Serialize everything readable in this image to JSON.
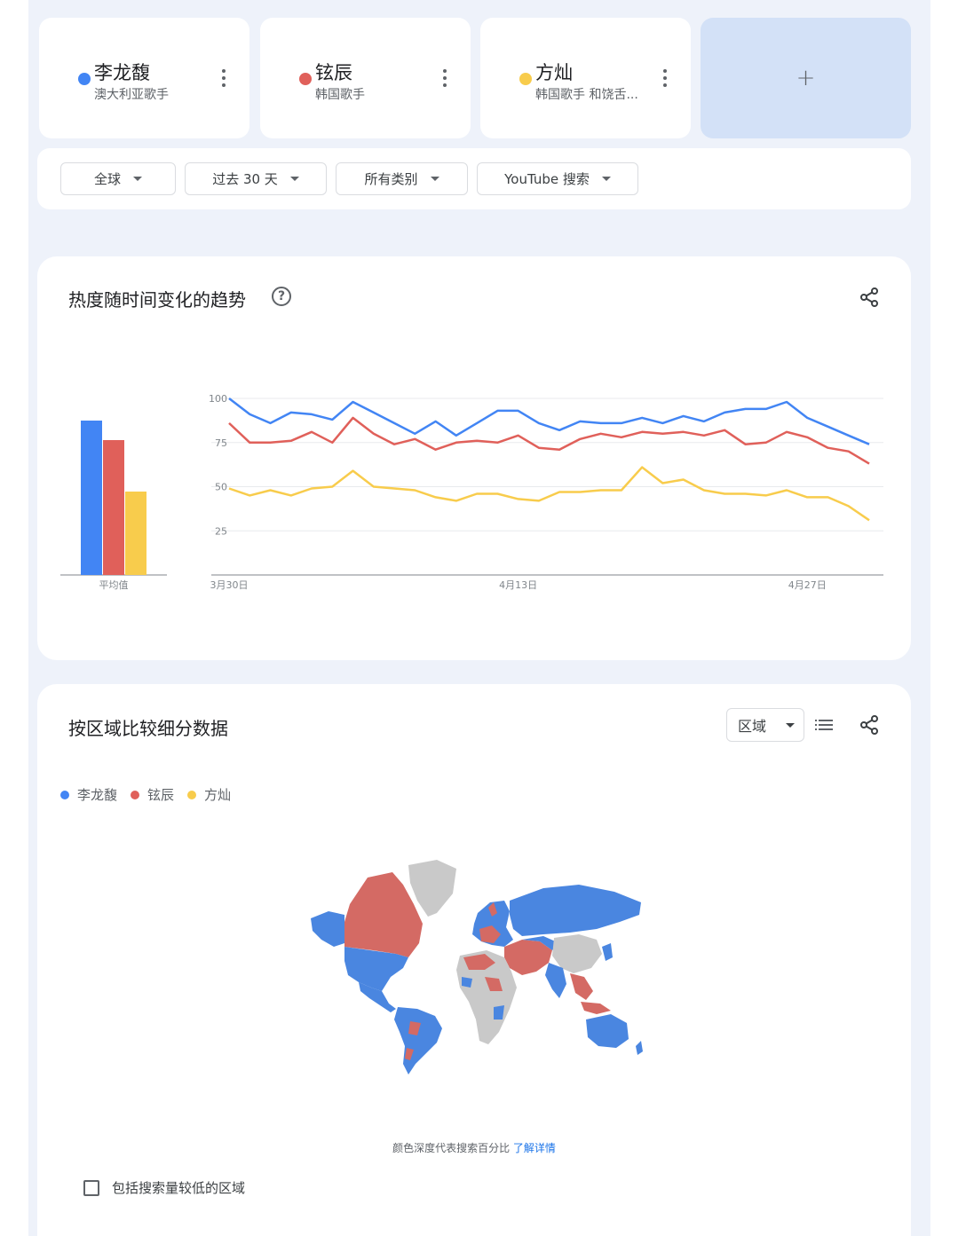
{
  "terms": [
    {
      "name": "李龙馥",
      "subtitle": "澳大利亚歌手",
      "color": "#4285f4"
    },
    {
      "name": "铉辰",
      "subtitle": "韩国歌手",
      "color": "#e0605a"
    },
    {
      "name": "方灿",
      "subtitle": "韩国歌手 和饶舌...",
      "color": "#f8cc4c"
    }
  ],
  "add_label": "+",
  "filters": {
    "region": "全球",
    "time": "过去 30 天",
    "category": "所有类别",
    "source": "YouTube 搜索"
  },
  "interest_over_time": {
    "title": "热度随时间变化的趋势",
    "help_icon": "help-circle-icon",
    "share_icon": "share-icon",
    "help_glyph": "?"
  },
  "chart_data": {
    "type": "line",
    "averages": {
      "label": "平均值",
      "values": [
        87,
        76,
        47
      ]
    },
    "ylim": [
      0,
      100
    ],
    "yticks": [
      25,
      50,
      75,
      100
    ],
    "xtick_labels": [
      {
        "label": "3月30日",
        "index": 0
      },
      {
        "label": "4月13日",
        "index": 14
      },
      {
        "label": "4月27日",
        "index": 28
      }
    ],
    "grid": true,
    "series": [
      {
        "name": "李龙馥",
        "color": "#4285f4",
        "values": [
          100,
          91,
          86,
          92,
          91,
          88,
          98,
          92,
          86,
          80,
          87,
          79,
          86,
          93,
          93,
          86,
          82,
          87,
          86,
          86,
          89,
          86,
          90,
          87,
          92,
          94,
          94,
          98,
          89,
          84,
          79,
          74
        ]
      },
      {
        "name": "铉辰",
        "color": "#e0605a",
        "values": [
          86,
          75,
          75,
          76,
          81,
          75,
          89,
          80,
          74,
          77,
          71,
          75,
          76,
          75,
          79,
          72,
          71,
          77,
          80,
          78,
          81,
          80,
          81,
          79,
          82,
          74,
          75,
          81,
          78,
          72,
          70,
          63
        ]
      },
      {
        "name": "方灿",
        "color": "#f8cc4c",
        "values": [
          49,
          45,
          48,
          45,
          49,
          50,
          59,
          50,
          49,
          48,
          44,
          42,
          46,
          46,
          43,
          42,
          47,
          47,
          48,
          48,
          61,
          52,
          54,
          48,
          46,
          46,
          45,
          48,
          44,
          44,
          39,
          31
        ]
      }
    ]
  },
  "region_breakdown": {
    "title": "按区域比较细分数据",
    "region_select": "区域",
    "list_icon": "list-icon",
    "share_icon": "share-icon",
    "legend": [
      {
        "name": "李龙馥",
        "color": "#4285f4"
      },
      {
        "name": "铉辰",
        "color": "#e0605a"
      },
      {
        "name": "方灿",
        "color": "#f8cc4c"
      }
    ],
    "map_icon": "world-map",
    "note_text": "颜色深度代表搜索百分比",
    "note_link": "了解详情",
    "checkbox_label": "包括搜索量较低的区域"
  }
}
